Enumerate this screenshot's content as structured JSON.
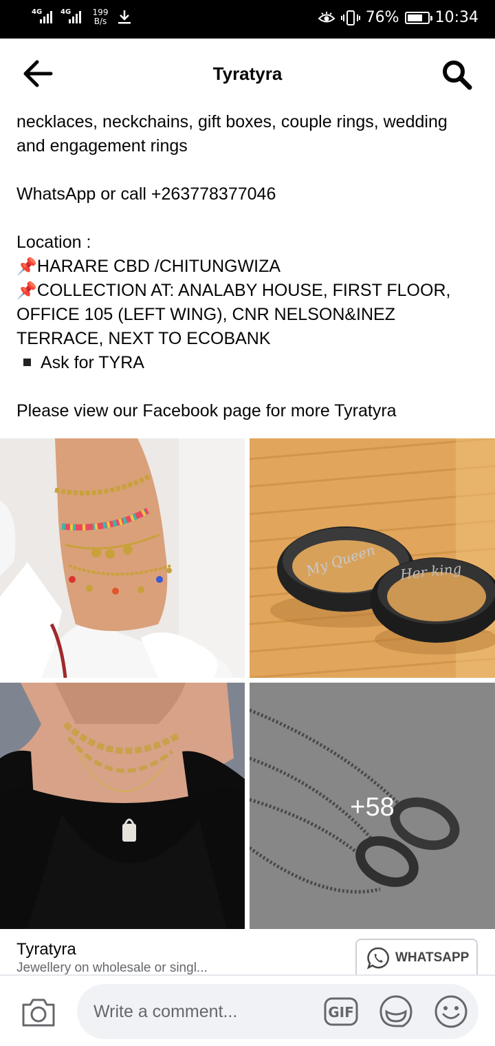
{
  "status_bar": {
    "net1": "4G",
    "net2": "4G",
    "speed_value": "199",
    "speed_unit": "B/s",
    "battery_pct": "76%",
    "battery_level": 0.76,
    "time": "10:34",
    "icons": [
      "signal-icon",
      "download-icon",
      "eye-comfort-icon",
      "vibrate-icon",
      "battery-icon"
    ]
  },
  "header": {
    "title": "Tyratyra",
    "back_icon": "arrow-left-icon",
    "search_icon": "search-icon"
  },
  "post": {
    "lines": [
      "necklaces, neckchains, gift boxes, couple rings, wedding",
      "and engagement rings",
      "",
      "WhatsApp or call +263778377046",
      "",
      "Location :",
      "HARARE CBD /CHITUNGWIZA",
      "COLLECTION AT: ANALABY HOUSE, FIRST FLOOR,",
      "OFFICE 105 (LEFT WING), CNR NELSON&INEZ",
      "TERRACE, NEXT TO ECOBANK",
      "Ask for TYRA",
      "",
      "Please view our Facebook page for more Tyratyra"
    ],
    "pin_glyph": "📌"
  },
  "photos": {
    "items": [
      "anklets-photo",
      "couple-rings-photo",
      "necklace-photo",
      "pendant-rings-photo"
    ],
    "more_count": "+58"
  },
  "preview": {
    "title": "Tyratyra",
    "subtitle": "Jewellery on wholesale or singl...",
    "whatsapp_label": "WHATSAPP"
  },
  "comment_bar": {
    "placeholder": "Write a comment...",
    "gif_label": "GIF"
  },
  "colors": {
    "status_bar_bg": "#000000",
    "comment_field_bg": "#f0f2f5",
    "secondary_text": "#65676b"
  }
}
